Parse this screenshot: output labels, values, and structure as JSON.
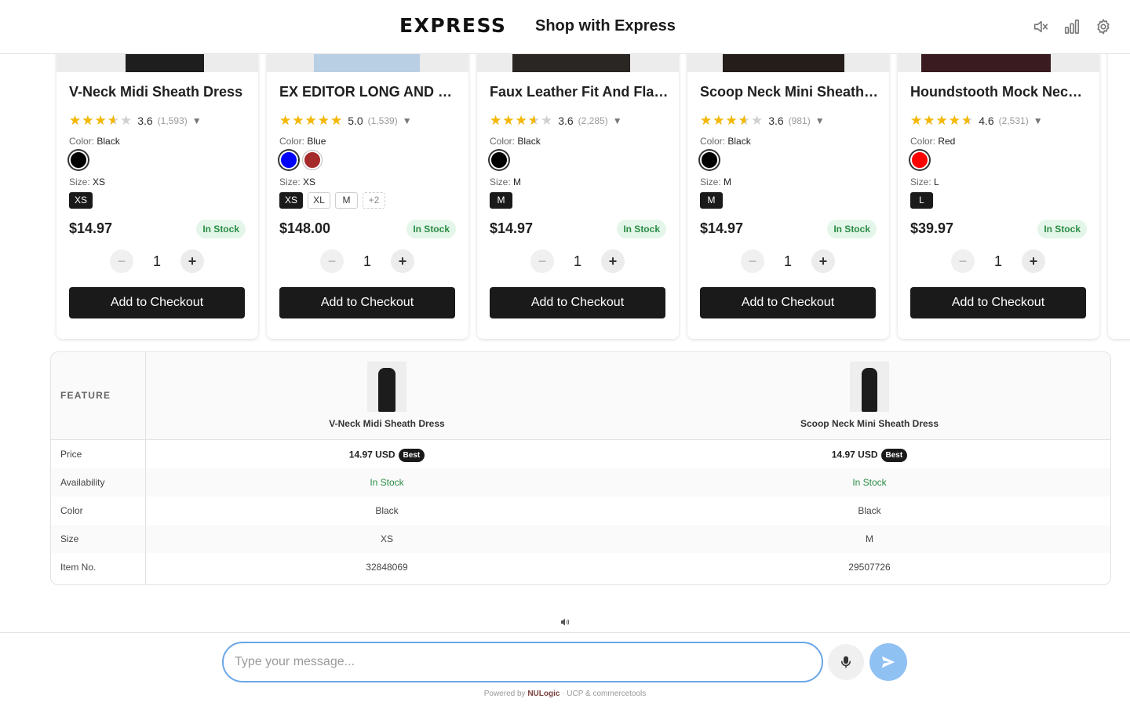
{
  "header": {
    "logo": "EXPRESS",
    "title": "Shop with Express",
    "icons": [
      "mute-icon",
      "stats-icon",
      "settings-icon"
    ]
  },
  "products": [
    {
      "name": "V-Neck Midi Sheath Dress",
      "rating": 3.6,
      "rating_text": "3.6",
      "reviews": "(1,593)",
      "color_label": "Color: ",
      "color": "Black",
      "swatches": [
        "#000000"
      ],
      "size_label": "Size: ",
      "size": "XS",
      "sizes": [
        "XS"
      ],
      "price": "$14.97",
      "stock": "In Stock",
      "qty": "1",
      "add_label": "Add to Checkout"
    },
    {
      "name": "EX EDITOR LONG AND LEAN PANT",
      "rating": 5.0,
      "rating_text": "5.0",
      "reviews": "(1,539)",
      "color_label": "Color: ",
      "color": "Blue",
      "swatches": [
        "#0000ff",
        "#a52a2a"
      ],
      "size_label": "Size: ",
      "size": "XS",
      "sizes": [
        "XS",
        "XL",
        "M",
        "+2"
      ],
      "price": "$148.00",
      "stock": "In Stock",
      "qty": "1",
      "add_label": "Add to Checkout"
    },
    {
      "name": "Faux Leather Fit And Flare Dress",
      "rating": 3.6,
      "rating_text": "3.6",
      "reviews": "(2,285)",
      "color_label": "Color: ",
      "color": "Black",
      "swatches": [
        "#000000"
      ],
      "size_label": "Size: ",
      "size": "M",
      "sizes": [
        "M"
      ],
      "price": "$14.97",
      "stock": "In Stock",
      "qty": "1",
      "add_label": "Add to Checkout"
    },
    {
      "name": "Scoop Neck Mini Sheath Dress",
      "rating": 3.6,
      "rating_text": "3.6",
      "reviews": "(981)",
      "color_label": "Color: ",
      "color": "Black",
      "swatches": [
        "#000000"
      ],
      "size_label": "Size: ",
      "size": "M",
      "sizes": [
        "M"
      ],
      "price": "$14.97",
      "stock": "In Stock",
      "qty": "1",
      "add_label": "Add to Checkout"
    },
    {
      "name": "Houndstooth Mock Neck Dress",
      "rating": 4.6,
      "rating_text": "4.6",
      "reviews": "(2,531)",
      "color_label": "Color: ",
      "color": "Red",
      "swatches": [
        "#ff0000"
      ],
      "size_label": "Size: ",
      "size": "L",
      "sizes": [
        "L"
      ],
      "price": "$39.97",
      "stock": "In Stock",
      "qty": "1",
      "add_label": "Add to Checkout"
    }
  ],
  "comparison": {
    "feature_header": "FEATURE",
    "products": [
      "V-Neck Midi Sheath Dress",
      "Scoop Neck Mini Sheath Dress"
    ],
    "rows": [
      {
        "label": "Price",
        "values": [
          "14.97 USD",
          "14.97 USD"
        ],
        "badge": "Best"
      },
      {
        "label": "Availability",
        "values": [
          "In Stock",
          "In Stock"
        ]
      },
      {
        "label": "Color",
        "values": [
          "Black",
          "Black"
        ]
      },
      {
        "label": "Size",
        "values": [
          "XS",
          "M"
        ]
      },
      {
        "label": "Item No.",
        "values": [
          "32848069",
          "29507726"
        ]
      }
    ]
  },
  "chat": {
    "placeholder": "Type your message...",
    "powered_prefix": "Powered by ",
    "powered_brand": "NULogic",
    "powered_suffix": " · UCP & commercetools"
  },
  "colors": {
    "accent": "#6aa6e8",
    "send_button": "#90c1f3",
    "in_stock_bg": "#e4f6e9",
    "in_stock_text": "#2a8c45",
    "star": "#f5b800"
  }
}
